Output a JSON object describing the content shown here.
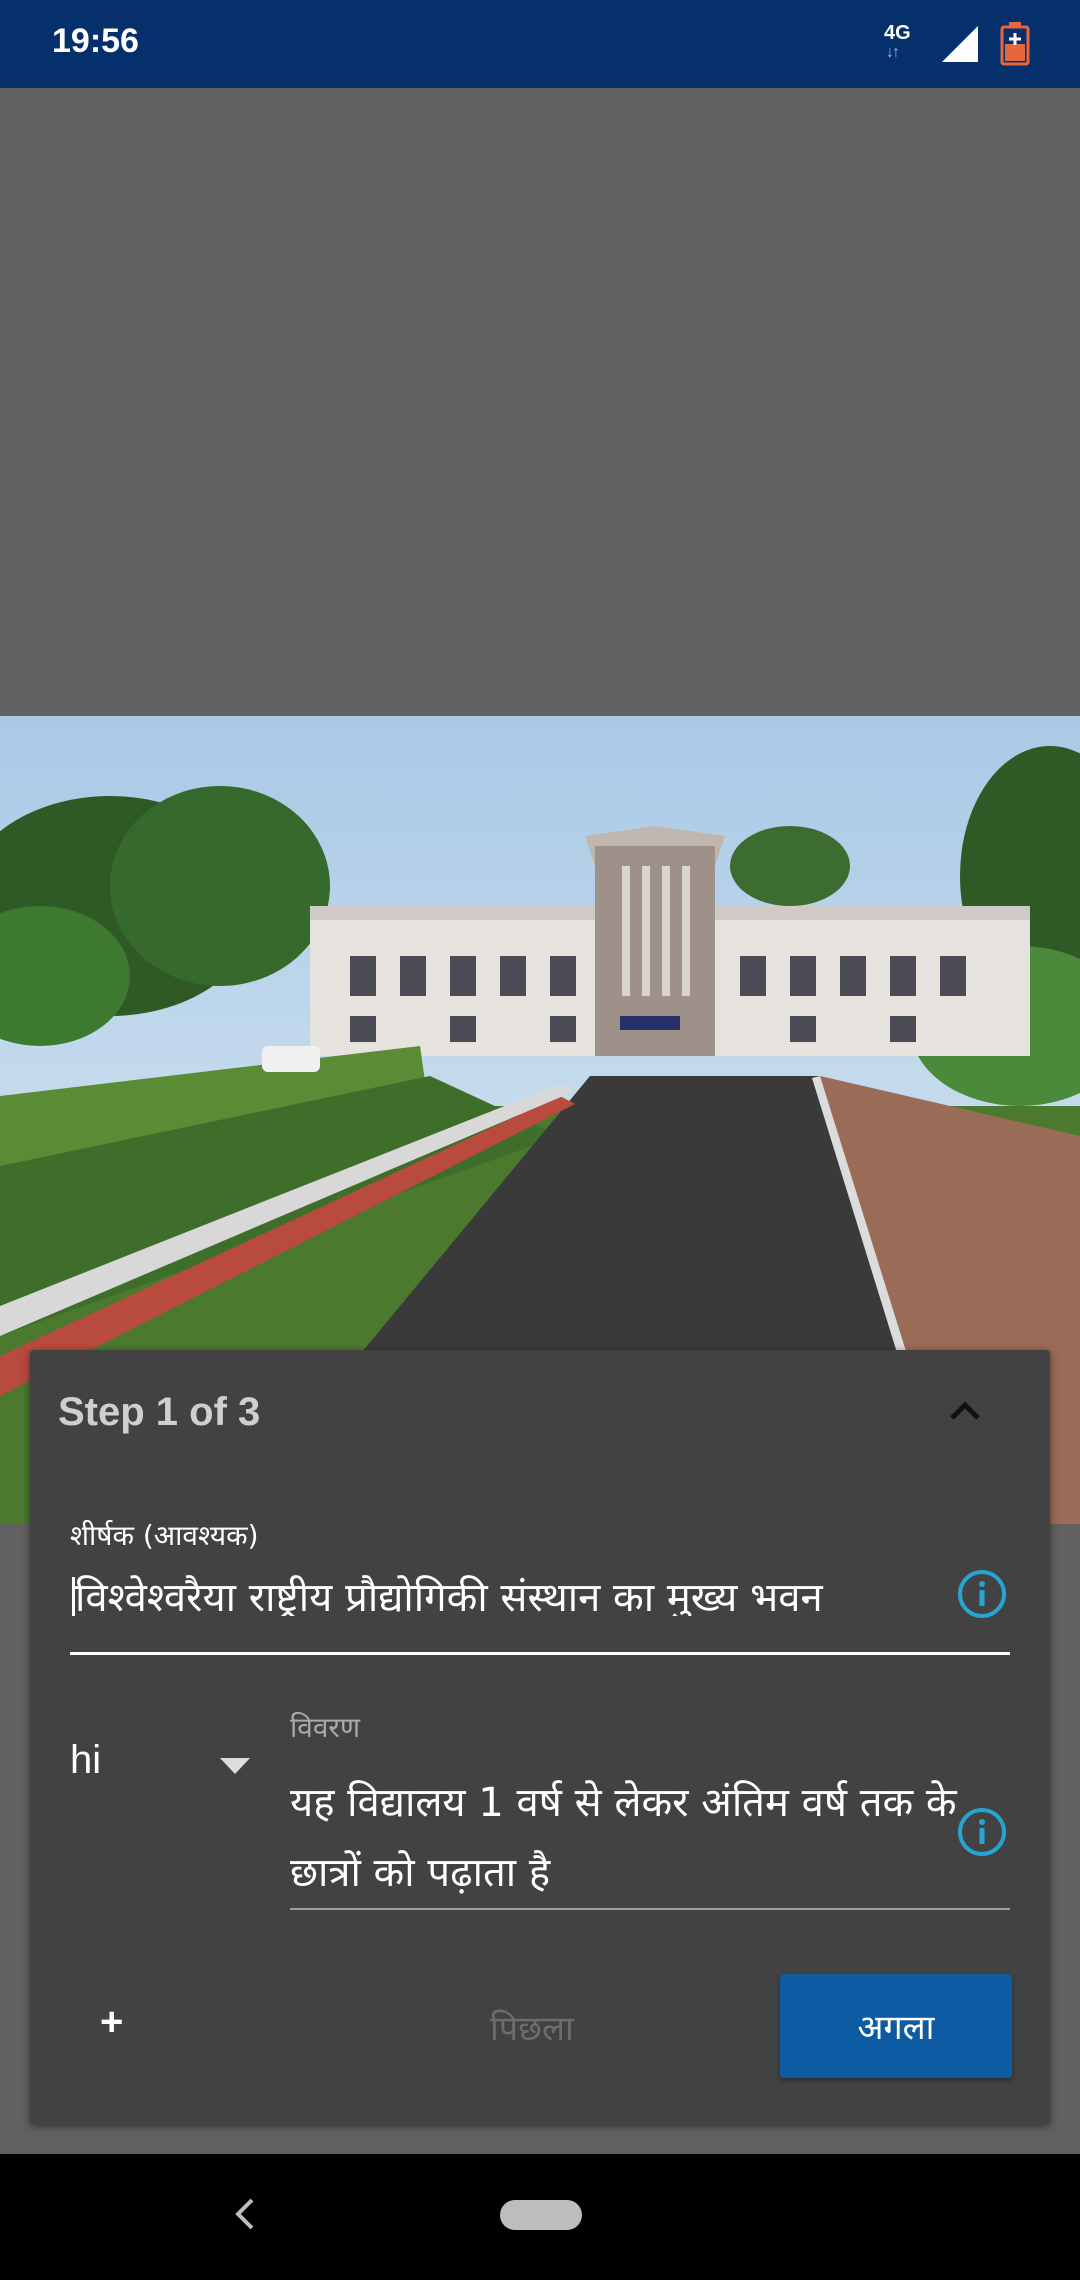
{
  "status_bar": {
    "time": "19:56",
    "network": "4G",
    "network_arrows": "↓↑"
  },
  "wizard": {
    "step_title": "Step 1 of 3",
    "title_field": {
      "label": "शीर्षक (आवश्यक)",
      "value": "विश्वेश्वरैया राष्ट्रीय प्रौद्योगिकी संस्थान का मुख्य भवन"
    },
    "language": {
      "value": "hi"
    },
    "description": {
      "label": "विवरण",
      "value": "यह विद्यालय 1 वर्ष से लेकर अंतिम वर्ष तक के छात्रों को पढ़ाता है"
    },
    "add_label": "+",
    "prev_label": "पिछला",
    "next_label": "अगला"
  },
  "colors": {
    "status_bar": "#05306b",
    "sheet": "#424242",
    "primary_button": "#0d5ca3",
    "info_icon": "#29a3d1",
    "battery": "#e8663d"
  }
}
